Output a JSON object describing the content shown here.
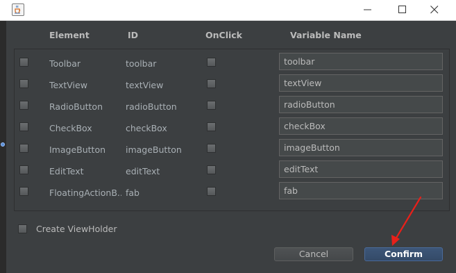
{
  "window": {
    "icon": "java-cup-icon",
    "controls": [
      "minimize-icon",
      "maximize-icon",
      "close-icon"
    ]
  },
  "headers": {
    "element": "Element",
    "id": "ID",
    "onclick": "OnClick",
    "variable_name": "Variable Name"
  },
  "rows": [
    {
      "element": "Toolbar",
      "id": "toolbar",
      "variable": "toolbar",
      "selected": false,
      "onclick": false
    },
    {
      "element": "TextView",
      "id": "textView",
      "variable": "textView",
      "selected": false,
      "onclick": false
    },
    {
      "element": "RadioButton",
      "id": "radioButton",
      "variable": "radioButton",
      "selected": false,
      "onclick": false
    },
    {
      "element": "CheckBox",
      "id": "checkBox",
      "variable": "checkBox",
      "selected": false,
      "onclick": false
    },
    {
      "element": "ImageButton",
      "id": "imageButton",
      "variable": "imageButton",
      "selected": false,
      "onclick": false
    },
    {
      "element": "EditText",
      "id": "editText",
      "variable": "editText",
      "selected": false,
      "onclick": false
    },
    {
      "element": "FloatingActionB...",
      "id": "fab",
      "variable": "fab",
      "selected": false,
      "onclick": false
    }
  ],
  "view_holder": {
    "label": "Create ViewHolder",
    "checked": false
  },
  "buttons": {
    "cancel": "Cancel",
    "confirm": "Confirm"
  },
  "colors": {
    "background": "#3c3f41",
    "annotation_arrow": "#e8201a",
    "confirm_accent": "#3d5678"
  }
}
